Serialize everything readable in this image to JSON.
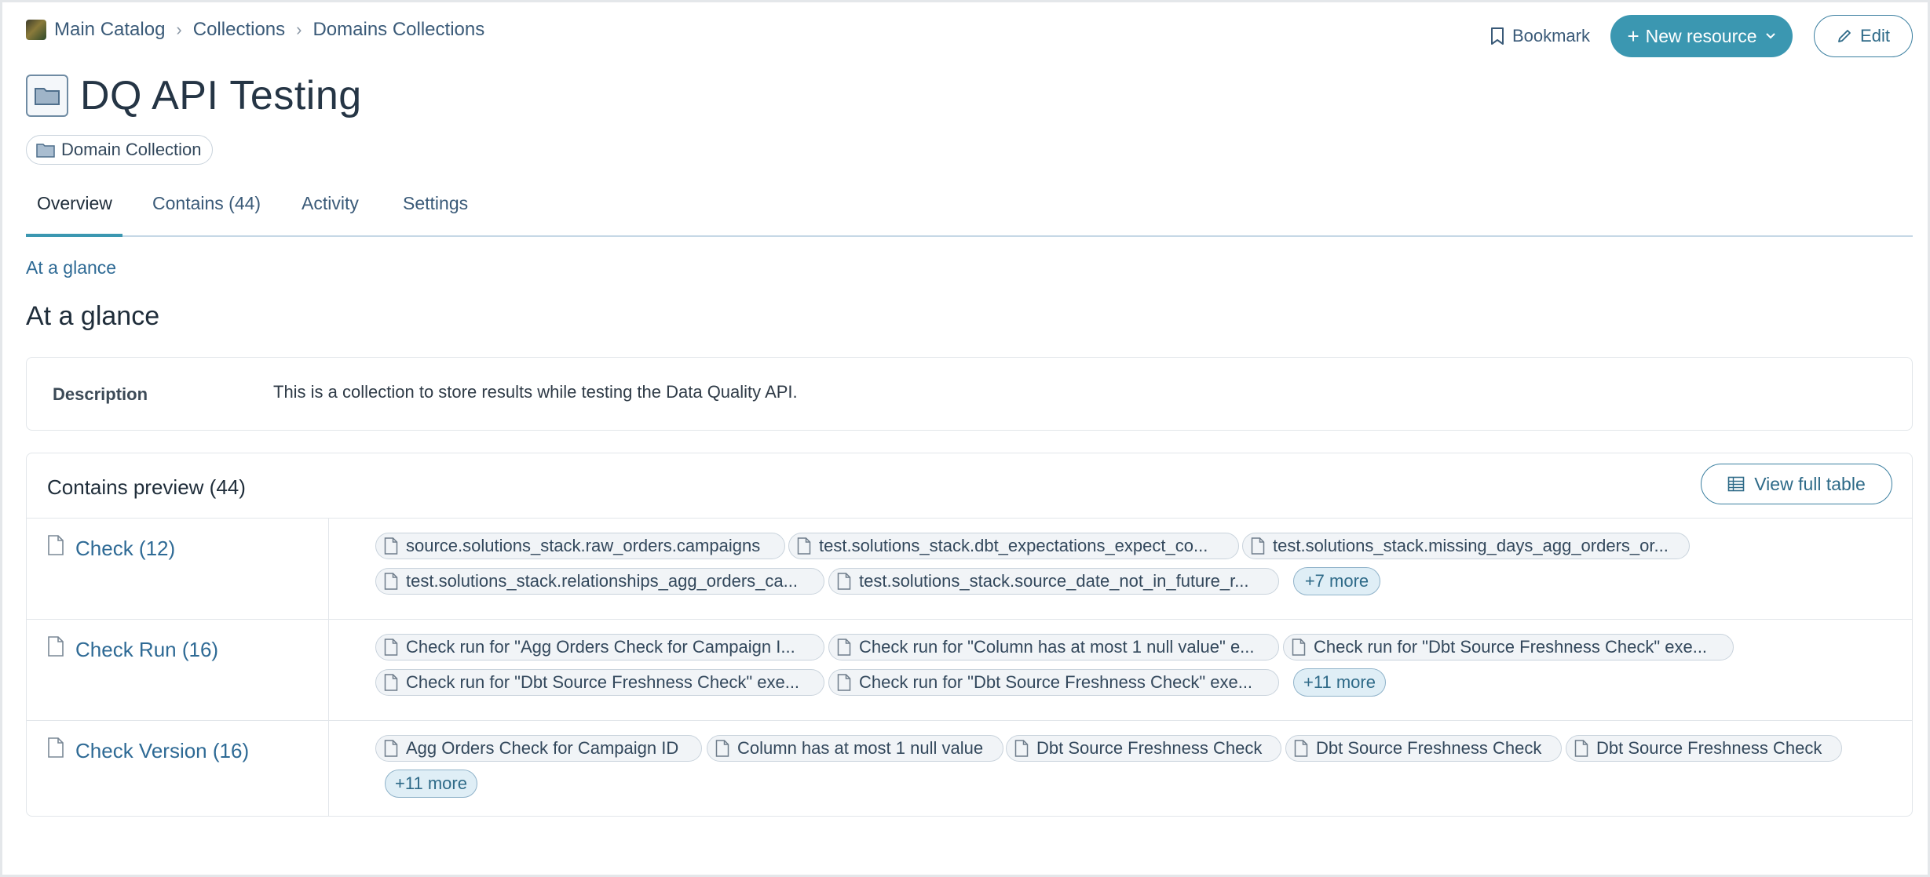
{
  "breadcrumb": {
    "items": [
      "Main Catalog",
      "Collections",
      "Domains Collections"
    ]
  },
  "header": {
    "bookmark_label": "Bookmark",
    "new_resource_label": "New resource",
    "edit_label": "Edit",
    "new_resource_color": "#3b97b1"
  },
  "page": {
    "title": "DQ API Testing",
    "type_chip": "Domain Collection"
  },
  "tabs": [
    {
      "label": "Overview",
      "active": true
    },
    {
      "label": "Contains (44)"
    },
    {
      "label": "Activity"
    },
    {
      "label": "Settings"
    }
  ],
  "anchor_link": "At a glance",
  "section_title": "At a glance",
  "description": {
    "label": "Description",
    "text": "This is a collection to store results while testing the Data Quality API."
  },
  "preview": {
    "title": "Contains preview (44)",
    "view_full_table_label": "View full table",
    "rows": [
      {
        "type": "Check (12)",
        "items": [
          "source.solutions_stack.raw_orders.campaigns",
          "test.solutions_stack.dbt_expectations_expect_co...",
          "test.solutions_stack.missing_days_agg_orders_or...",
          "test.solutions_stack.relationships_agg_orders_ca...",
          "test.solutions_stack.source_date_not_in_future_r..."
        ],
        "more": "+7 more"
      },
      {
        "type": "Check Run (16)",
        "items": [
          "Check run for \"Agg Orders Check for Campaign I...",
          "Check run for \"Column has at most 1 null value\" e...",
          "Check run for \"Dbt Source Freshness Check\" exe...",
          "Check run for \"Dbt Source Freshness Check\" exe...",
          "Check run for \"Dbt Source Freshness Check\" exe..."
        ],
        "more": "+11 more"
      },
      {
        "type": "Check Version (16)",
        "items": [
          "Agg Orders Check for Campaign ID",
          "Column has at most 1 null value",
          "Dbt Source Freshness Check",
          "Dbt Source Freshness Check",
          "Dbt Source Freshness Check"
        ],
        "more": "+11 more"
      }
    ]
  },
  "icons": {
    "bookmark": "bookmark-icon",
    "edit": "pencil-icon",
    "folder": "folder-icon",
    "table": "table-icon",
    "document": "document-icon"
  }
}
